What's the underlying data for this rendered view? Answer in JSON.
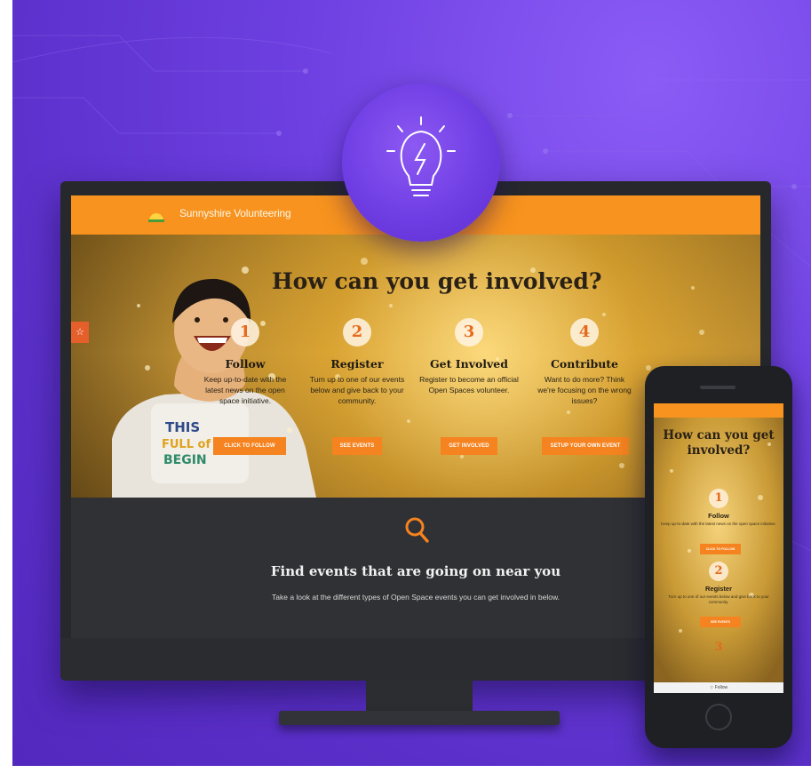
{
  "site": {
    "name": "Sunnyshire Volunteering",
    "logo_icon": "sunrise-logo-icon",
    "side_tab_icon": "star-icon"
  },
  "hero": {
    "title": "How can you get involved?",
    "steps": [
      {
        "number": "1",
        "title": "Follow",
        "description": "Keep up-to-date with the latest news on the open space initiative.",
        "button": "CLICK TO FOLLOW"
      },
      {
        "number": "2",
        "title": "Register",
        "description": "Turn up to one of our events below and give back to your community.",
        "button": "SEE EVENTS"
      },
      {
        "number": "3",
        "title": "Get Involved",
        "description": "Register to become an official Open Spaces volunteer.",
        "button": "GET INVOLVED"
      },
      {
        "number": "4",
        "title": "Contribute",
        "description": "Want to do more? Think we're focusing on the wrong issues?",
        "button": "SETUP YOUR OWN EVENT"
      }
    ]
  },
  "find_events": {
    "icon": "search-icon",
    "title": "Find events that are going on near you",
    "subtitle": "Take a look at the different types of Open Space events you can get involved in below."
  },
  "idea_badge": {
    "icon": "lightbulb-icon"
  },
  "mobile": {
    "title": "How can you get involved?",
    "steps": [
      {
        "number": "1",
        "title": "Follow",
        "description": "Keep up-to-date with the latest news on the open space initiative.",
        "button": "CLICK TO FOLLOW"
      },
      {
        "number": "2",
        "title": "Register",
        "description": "Turn up to one of our events below and give back to your community.",
        "button": "SEE EVENTS"
      },
      {
        "number": "3"
      }
    ],
    "footer_icon": "star-icon",
    "footer_label": "Follow"
  },
  "colors": {
    "background": "#6d3fe0",
    "brand_orange": "#f7931e",
    "button_orange": "#f5831f",
    "number_orange": "#e56a1e",
    "dark_section": "#303134"
  }
}
